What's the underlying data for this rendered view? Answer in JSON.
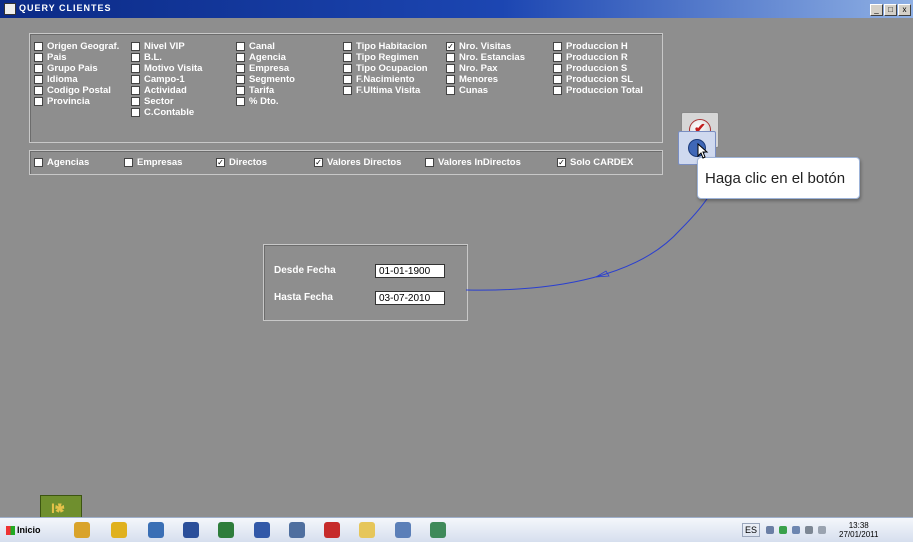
{
  "window": {
    "title": "QUERY  CLIENTES",
    "btn_min": "_",
    "btn_max": "□",
    "btn_close": "x"
  },
  "fields": [
    {
      "label": "Origen Geograf.",
      "checked": false,
      "col": 0,
      "row": 0
    },
    {
      "label": "Pais",
      "checked": false,
      "col": 0,
      "row": 1
    },
    {
      "label": "Grupo Pais",
      "checked": false,
      "col": 0,
      "row": 2
    },
    {
      "label": "Idioma",
      "checked": false,
      "col": 0,
      "row": 3
    },
    {
      "label": "Codigo Postal",
      "checked": false,
      "col": 0,
      "row": 4
    },
    {
      "label": "Provincia",
      "checked": false,
      "col": 0,
      "row": 5
    },
    {
      "label": "Nivel VIP",
      "checked": false,
      "col": 1,
      "row": 0
    },
    {
      "label": "B.L.",
      "checked": false,
      "col": 1,
      "row": 1
    },
    {
      "label": "Motivo Visita",
      "checked": false,
      "col": 1,
      "row": 2
    },
    {
      "label": "Campo-1",
      "checked": false,
      "col": 1,
      "row": 3
    },
    {
      "label": "Actividad",
      "checked": false,
      "col": 1,
      "row": 4
    },
    {
      "label": "Sector",
      "checked": false,
      "col": 1,
      "row": 5
    },
    {
      "label": "C.Contable",
      "checked": false,
      "col": 1,
      "row": 6
    },
    {
      "label": "Canal",
      "checked": false,
      "col": 2,
      "row": 0
    },
    {
      "label": "Agencia",
      "checked": false,
      "col": 2,
      "row": 1
    },
    {
      "label": "Empresa",
      "checked": false,
      "col": 2,
      "row": 2
    },
    {
      "label": "Segmento",
      "checked": false,
      "col": 2,
      "row": 3
    },
    {
      "label": "Tarifa",
      "checked": false,
      "col": 2,
      "row": 4
    },
    {
      "label": "% Dto.",
      "checked": false,
      "col": 2,
      "row": 5
    },
    {
      "label": "Tipo Habitacion",
      "checked": false,
      "col": 3,
      "row": 0
    },
    {
      "label": "Tipo Regimen",
      "checked": false,
      "col": 3,
      "row": 1
    },
    {
      "label": "Tipo Ocupacion",
      "checked": false,
      "col": 3,
      "row": 2
    },
    {
      "label": "F.Nacimiento",
      "checked": false,
      "col": 3,
      "row": 3
    },
    {
      "label": "F.Ultima Visita",
      "checked": false,
      "col": 3,
      "row": 4
    },
    {
      "label": "Nro. Visitas",
      "checked": true,
      "col": 4,
      "row": 0
    },
    {
      "label": "Nro. Estancias",
      "checked": false,
      "col": 4,
      "row": 1
    },
    {
      "label": "Nro. Pax",
      "checked": false,
      "col": 4,
      "row": 2
    },
    {
      "label": "Menores",
      "checked": false,
      "col": 4,
      "row": 3
    },
    {
      "label": "Cunas",
      "checked": false,
      "col": 4,
      "row": 4
    },
    {
      "label": "Produccion H",
      "checked": false,
      "col": 5,
      "row": 0
    },
    {
      "label": "Produccion R",
      "checked": false,
      "col": 5,
      "row": 1
    },
    {
      "label": "Produccion S",
      "checked": false,
      "col": 5,
      "row": 2
    },
    {
      "label": "Produccion SL",
      "checked": false,
      "col": 5,
      "row": 3
    },
    {
      "label": "Produccion Total",
      "checked": false,
      "col": 5,
      "row": 4
    }
  ],
  "filters": [
    {
      "label": "Agencias",
      "checked": false
    },
    {
      "label": "Empresas",
      "checked": false
    },
    {
      "label": "Directos",
      "checked": true
    },
    {
      "label": "Valores Directos",
      "checked": true
    },
    {
      "label": "Valores InDirectos",
      "checked": false
    },
    {
      "label": "Solo CARDEX",
      "checked": true
    }
  ],
  "dates": {
    "desde_label": "Desde Fecha",
    "desde_value": "01-01-1900",
    "hasta_label": "Hasta Fecha",
    "hasta_value": "03-07-2010"
  },
  "tooltip": {
    "text": "Haga clic en el botón"
  },
  "taskbar": {
    "start_label": "Inicio",
    "apps": [
      {
        "name": "chrome-icon",
        "color": "#d9a32a"
      },
      {
        "name": "outlook-icon",
        "color": "#e0b11e"
      },
      {
        "name": "browser-icon",
        "color": "#3a6fb5"
      },
      {
        "name": "save-disk-icon",
        "color": "#2b4f9a"
      },
      {
        "name": "excel-icon",
        "color": "#2e7d3b"
      },
      {
        "name": "word-icon",
        "color": "#3158a8"
      },
      {
        "name": "network-icon",
        "color": "#4f6f9f"
      },
      {
        "name": "app-c-icon",
        "color": "#c62b2b"
      },
      {
        "name": "folder-icon",
        "color": "#e6c65a"
      },
      {
        "name": "captivate-app-icon",
        "color": "#5b7fb8"
      },
      {
        "name": "cp-icon",
        "color": "#3f8a5a"
      }
    ],
    "lang": "ES",
    "time": "13:38",
    "date": "27/01/2011"
  }
}
